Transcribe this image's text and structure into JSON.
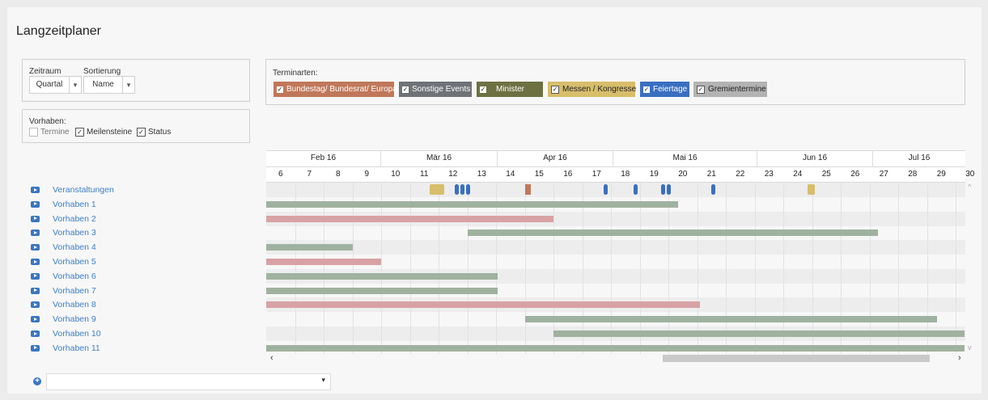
{
  "page_title": "Langzeitplaner",
  "filters": {
    "zeitraum_label": "Zeitraum",
    "zeitraum_value": "Quartal",
    "sortierung_label": "Sortierung",
    "sortierung_value": "Name",
    "vorhaben_label": "Vorhaben:",
    "vorhaben_options": [
      {
        "label": "Termine",
        "checked": false
      },
      {
        "label": "Meilensteine",
        "checked": true
      },
      {
        "label": "Status",
        "checked": true
      }
    ]
  },
  "terminarten": {
    "label": "Terminarten:",
    "chips": [
      {
        "label": "Bundestag/ Bundesrat/ Europa",
        "color": "#c0785a",
        "checked": true
      },
      {
        "label": "Sonstige Events",
        "color": "#6f7378",
        "checked": true
      },
      {
        "label": "Minister",
        "color": "#6d7142",
        "checked": true
      },
      {
        "label": "Messen / Kongresse",
        "color": "#d8be6b",
        "checked": true
      },
      {
        "label": "Feiertage",
        "color": "#3a6fc0",
        "checked": true
      },
      {
        "label": "Gremientermine",
        "color": "#b3b3b3",
        "checked": true
      }
    ]
  },
  "timeline": {
    "months": [
      "Feb 16",
      "Mär 16",
      "Apr 16",
      "Mai 16",
      "Jun 16",
      "Jul 16"
    ],
    "weeks": [
      "6",
      "7",
      "8",
      "9",
      "10",
      "11",
      "12",
      "13",
      "14",
      "15",
      "16",
      "17",
      "18",
      "19",
      "20",
      "21",
      "22",
      "23",
      "24",
      "25",
      "26",
      "27",
      "28",
      "29",
      "30"
    ]
  },
  "rows": [
    {
      "name": "Veranstaltungen"
    },
    {
      "name": "Vorhaben 1",
      "bar": {
        "start": 0,
        "end": 14.35,
        "color": "green"
      }
    },
    {
      "name": "Vorhaben 2",
      "bar": {
        "start": 0,
        "end": 10.0,
        "color": "red"
      }
    },
    {
      "name": "Vorhaben 3",
      "bar": {
        "start": 7.0,
        "end": 21.3,
        "color": "green"
      }
    },
    {
      "name": "Vorhaben 4",
      "bar": {
        "start": 0,
        "end": 3.0,
        "color": "green"
      }
    },
    {
      "name": "Vorhaben 5",
      "bar": {
        "start": 0,
        "end": 4.0,
        "color": "red"
      }
    },
    {
      "name": "Vorhaben 6",
      "bar": {
        "start": 0,
        "end": 8.05,
        "color": "green"
      }
    },
    {
      "name": "Vorhaben 7",
      "bar": {
        "start": 0,
        "end": 8.05,
        "color": "green"
      }
    },
    {
      "name": "Vorhaben 8",
      "bar": {
        "start": 0,
        "end": 15.1,
        "color": "red"
      }
    },
    {
      "name": "Vorhaben 9",
      "bar": {
        "start": 9.0,
        "end": 23.35,
        "color": "green"
      }
    },
    {
      "name": "Vorhaben 10",
      "bar": {
        "start": 10.0,
        "end": 24.3,
        "color": "green"
      }
    },
    {
      "name": "Vorhaben 11",
      "bar": {
        "start": 0,
        "end": 24.3,
        "color": "green"
      }
    }
  ],
  "events": [
    {
      "type": "messe",
      "week": 5.7,
      "width": 0.5
    },
    {
      "type": "feiertag",
      "week": 6.55
    },
    {
      "type": "feiertag",
      "week": 6.75
    },
    {
      "type": "feiertag",
      "week": 6.95
    },
    {
      "type": "bundestag",
      "week": 9.0
    },
    {
      "type": "feiertag",
      "week": 11.75
    },
    {
      "type": "feiertag",
      "week": 12.8
    },
    {
      "type": "feiertag",
      "week": 13.75
    },
    {
      "type": "feiertag",
      "week": 13.95
    },
    {
      "type": "feiertag",
      "week": 15.5
    },
    {
      "type": "messe",
      "week": 18.85,
      "width": 0.25
    }
  ],
  "scroll": {
    "left_arrow": "‹",
    "right_arrow": "›",
    "up_arrow": "^",
    "down_arrow": "v"
  },
  "footer": {
    "add_icon": "+",
    "dropdown_arrow": "▾"
  }
}
